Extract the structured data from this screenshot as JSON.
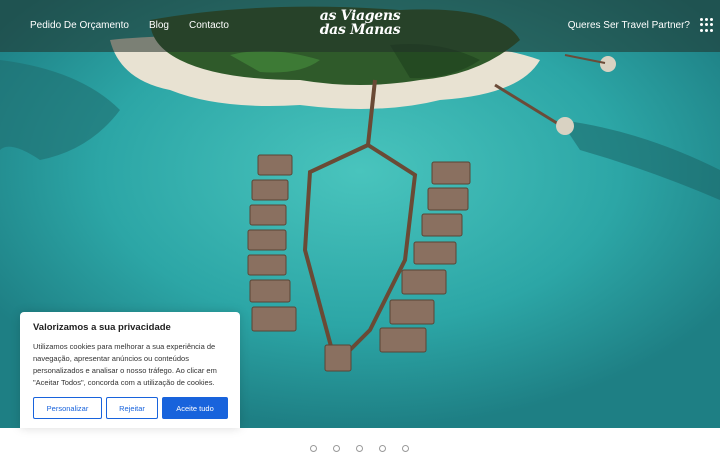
{
  "header": {
    "nav": [
      "Pedido De Orçamento",
      "Blog",
      "Contacto"
    ],
    "logo_line1": "as Viagens",
    "logo_line2": "das Manas",
    "partner_link": "Queres Ser Travel Partner?",
    "menu_icon": "grid-dots-icon"
  },
  "hero": {
    "image": "aerial-maldives-overwater-villas"
  },
  "carousel": {
    "dot_count": 5
  },
  "cookie_banner": {
    "title": "Valorizamos a sua privacidade",
    "body": "Utilizamos cookies para melhorar a sua experiência de navegação, apresentar anúncios ou conteúdos personalizados e analisar o nosso tráfego. Ao clicar em \"Aceitar Todos\", concorda com a utilização de cookies.",
    "customize_label": "Personalizar",
    "reject_label": "Rejeitar",
    "accept_label": "Aceite tudo"
  },
  "colors": {
    "accent": "#1863dc",
    "header_overlay": "#203028"
  }
}
